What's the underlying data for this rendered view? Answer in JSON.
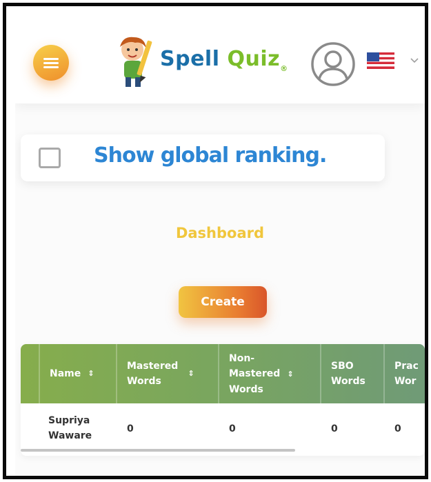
{
  "header": {
    "logo": {
      "word1": "Spell",
      "word2": "Quiz",
      "reg": "®"
    },
    "language_flag": "us-flag-icon",
    "colors": {
      "menu": "#f3a93a",
      "logo_blue": "#1b6fa8",
      "logo_green": "#7bbd2a"
    }
  },
  "ranking": {
    "label": "Show global ranking.",
    "checked": false
  },
  "dashboard": {
    "title": "Dashboard"
  },
  "create_button": {
    "label": "Create"
  },
  "table": {
    "columns": [
      {
        "line1": "Name",
        "line2": "",
        "line3": "",
        "sort": "⇕"
      },
      {
        "line1": "Mastered",
        "line2": "Words",
        "line3": "",
        "sort": "⇕"
      },
      {
        "line1": "Non-",
        "line2": "Mastered",
        "line3": "Words",
        "sort": "⇕"
      },
      {
        "line1": "SBO",
        "line2": "Words",
        "line3": "",
        "sort": ""
      },
      {
        "line1": "Prac",
        "line2": "Wor",
        "line3": "",
        "sort": ""
      }
    ],
    "rows": [
      {
        "name_line1": "Supriya",
        "name_line2": "Waware",
        "mastered": "0",
        "non_mastered": "0",
        "sbo": "0",
        "practice": "0"
      }
    ]
  }
}
